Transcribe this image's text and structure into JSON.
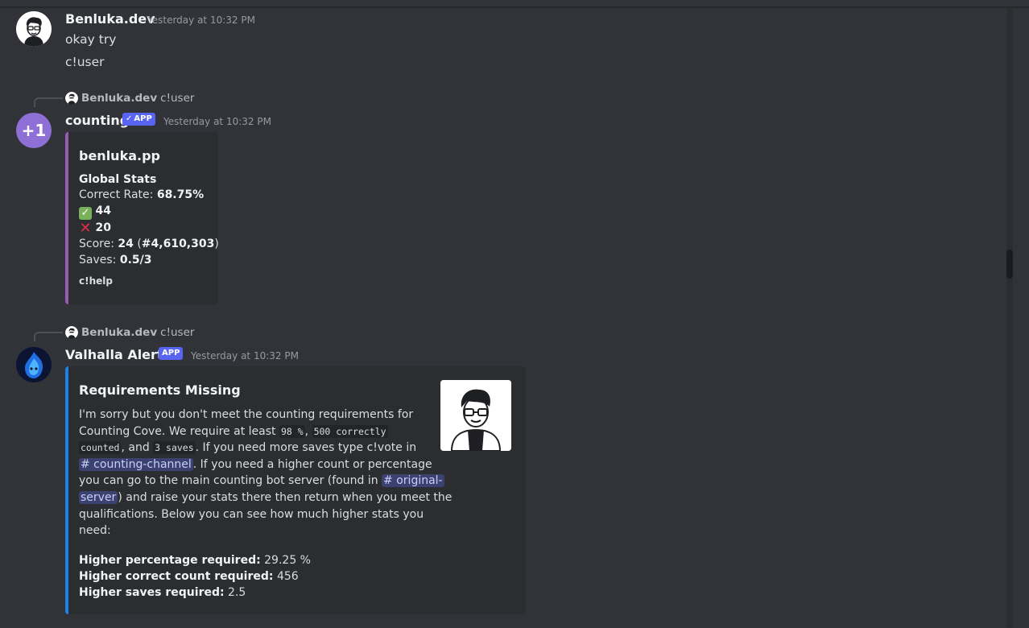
{
  "colors": {
    "background": "#313338",
    "embed_bg": "#2b2d31",
    "counting_embed_accent": "#9b59b6",
    "valhalla_embed_accent": "#1d82e8",
    "app_badge": "#5865f2",
    "mention_bg": "#3c4270"
  },
  "messages": [
    {
      "author": "Benluka.dev",
      "timestamp": "Yesterday at 10:32 PM",
      "avatar_icon": "cartoon-man-avatar-icon",
      "lines": [
        "okay try",
        "c!user"
      ]
    },
    {
      "reply": {
        "author": "Benluka.dev",
        "text": "c!user"
      },
      "author": "counting",
      "badge": "APP",
      "timestamp": "Yesterday at 10:32 PM",
      "avatar_icon": "plus-one-icon",
      "avatar_text": "+1",
      "embed": {
        "title": "benluka.pp",
        "subtitle": "Global Stats",
        "correct_rate_label": "Correct Rate: ",
        "correct_rate_value": "68.75%",
        "correct_count": "44",
        "wrong_count": "20",
        "score_label": "Score: ",
        "score_value": "24",
        "score_rank": "#4,610,303",
        "saves_label": "Saves: ",
        "saves_value": "0.5/3",
        "footer": "c!help"
      }
    },
    {
      "reply": {
        "author": "Benluka.dev",
        "text": "c!user"
      },
      "author": "Valhalla Alerts",
      "badge": "APP",
      "timestamp": "Yesterday at 10:32 PM",
      "avatar_icon": "blue-flame-avatar-icon",
      "embed": {
        "title": "Requirements Missing",
        "desc_1": "I'm sorry but you don't meet the counting requirements for",
        "desc_2": "Counting Cove. We require at least ",
        "code_1": "98 %",
        "code_2a": "500 correctly",
        "code_2b": "counted",
        "desc_3": ", and ",
        "code_3": "3 saves",
        "desc_4": ". If you need more saves type c!vote in",
        "mention_1": "# counting-channel",
        "desc_5": ". If you need a higher count or percentage",
        "desc_6": "you can go to the main counting bot server (found in ",
        "mention_2a": "# original-",
        "mention_2b": "server",
        "desc_7": ") and raise your stats there then return when you meet the",
        "desc_8": "qualifications. Below you can see how much higher stats you",
        "desc_9": "need:",
        "stats": [
          {
            "label": "Higher percentage required:",
            "value": " 29.25 %"
          },
          {
            "label": "Higher correct count required:",
            "value": " 456"
          },
          {
            "label": "Higher saves required:",
            "value": " 2.5"
          }
        ],
        "thumbnail_icon": "cartoon-man-thumbnail-icon"
      }
    }
  ]
}
